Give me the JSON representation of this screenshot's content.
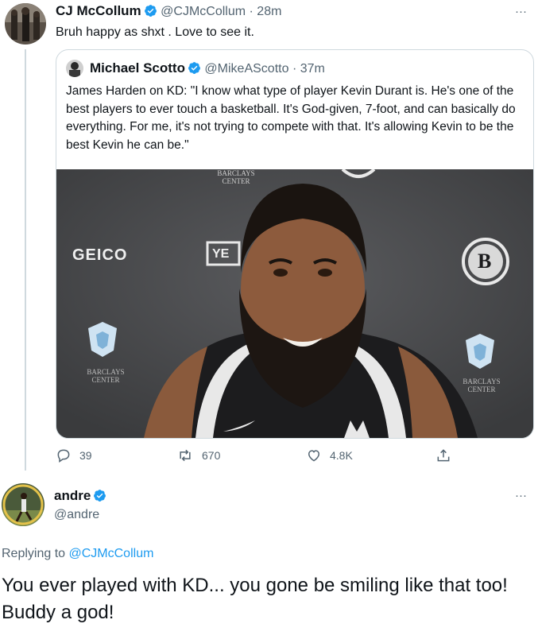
{
  "top_tweet": {
    "author_name": "CJ McCollum",
    "handle": "@CJMcCollum",
    "time": "28m",
    "text": "Bruh happy as shxt . Love to see it.",
    "more_label": "···"
  },
  "quoted_tweet": {
    "author_name": "Michael Scotto",
    "handle": "@MikeAScotto",
    "time": "37m",
    "text": "James Harden on KD: \"I know what type of player Kevin Durant is. He's one of the best players to ever touch a basketball. It's God-given, 7-foot, and can basically do everything. For me, it's not trying to compete with that. It's allowing Kevin to be the best Kevin he can be.\"",
    "media": {
      "sponsor_geico": "GEICO",
      "barclays_top": "BARCLAYS\nCENTER",
      "barclays_left": "BARCLAYS\nCENTER",
      "barclays_right": "BARCLAYS\nCENTER",
      "yes_logo": "YE",
      "nets_logo": "B"
    }
  },
  "actions": {
    "replies": "39",
    "retweets": "670",
    "likes": "4.8K"
  },
  "reply_tweet": {
    "author_name": "andre",
    "handle": "@andre",
    "more_label": "···",
    "replying_prefix": "Replying to",
    "replying_to": "@CJMcCollum",
    "text": "You ever played with KD... you gone be smiling like that too! Buddy a god!"
  },
  "colors": {
    "verified": "#1d9bf0",
    "muted": "#536471",
    "border": "#cfd9de"
  }
}
